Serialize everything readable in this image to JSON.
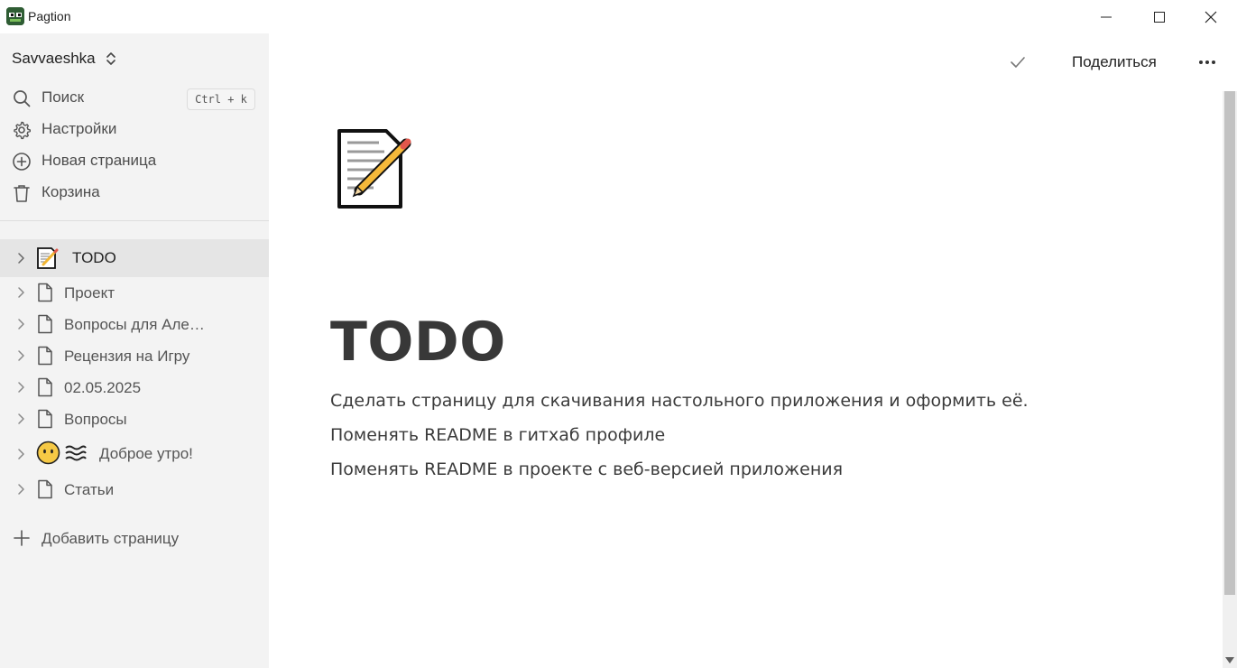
{
  "app": {
    "title": "Pagtion"
  },
  "window_controls": [
    "minimize",
    "maximize",
    "close"
  ],
  "sidebar": {
    "workspace": "Savvaeshka",
    "nav": [
      {
        "label": "Поиск",
        "icon": "search-icon"
      },
      {
        "label": "Настройки",
        "icon": "gear-icon"
      },
      {
        "label": "Новая страница",
        "icon": "plus-circle-icon"
      },
      {
        "label": "Корзина",
        "icon": "trash-icon"
      }
    ],
    "search_shortcut": "Ctrl + k",
    "pages": [
      {
        "label": "TODO",
        "icon": "memo-emoji-icon",
        "active": true
      },
      {
        "label": "Проект",
        "icon": "document-icon"
      },
      {
        "label": "Вопросы для Але…",
        "icon": "document-icon"
      },
      {
        "label": "Рецензия на Игру",
        "icon": "document-icon"
      },
      {
        "label": "02.05.2025",
        "icon": "document-icon"
      },
      {
        "label": "Вопросы",
        "icon": "document-icon"
      },
      {
        "label": "Доброе утро!",
        "icon": "face-without-mouth-emoji-icon"
      },
      {
        "label": "Статьи",
        "icon": "document-icon"
      }
    ],
    "add_page": "Добавить страницу"
  },
  "header": {
    "share": "Поделиться"
  },
  "page": {
    "title": "TODO",
    "paragraphs": [
      "Сделать страницу для скачивания настольного приложения и оформить её.",
      "Поменять README в гитхаб профиле",
      "Поменять README в проекте с веб-версией приложения"
    ]
  },
  "colors": {
    "sidebar_bg": "#f3f3f3",
    "active_row": "#e5e5e5",
    "text": "#37352f"
  }
}
